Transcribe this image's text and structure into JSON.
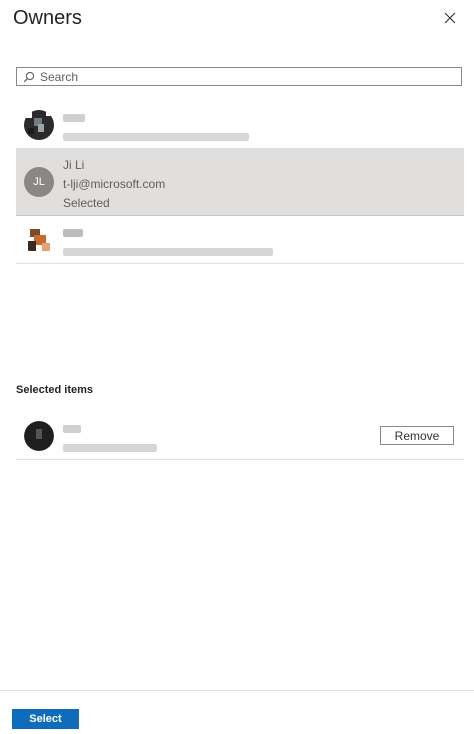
{
  "panel": {
    "title": "Owners"
  },
  "search": {
    "placeholder": "Search",
    "value": ""
  },
  "list": {
    "items": [
      {
        "state": "blurred"
      },
      {
        "initials": "JL",
        "name": "Ji Li",
        "email": "t-lji@microsoft.com",
        "status": "Selected",
        "state": "selected"
      },
      {
        "state": "blurred"
      }
    ]
  },
  "selected_section": {
    "title": "Selected items",
    "remove_label": "Remove"
  },
  "footer": {
    "select_label": "Select"
  },
  "colors": {
    "accent": "#0f6cbd",
    "selected_bg": "#e1dfdd",
    "initials_bg": "#8a8886"
  },
  "icons": {
    "close": "close-icon",
    "search": "search-icon"
  }
}
